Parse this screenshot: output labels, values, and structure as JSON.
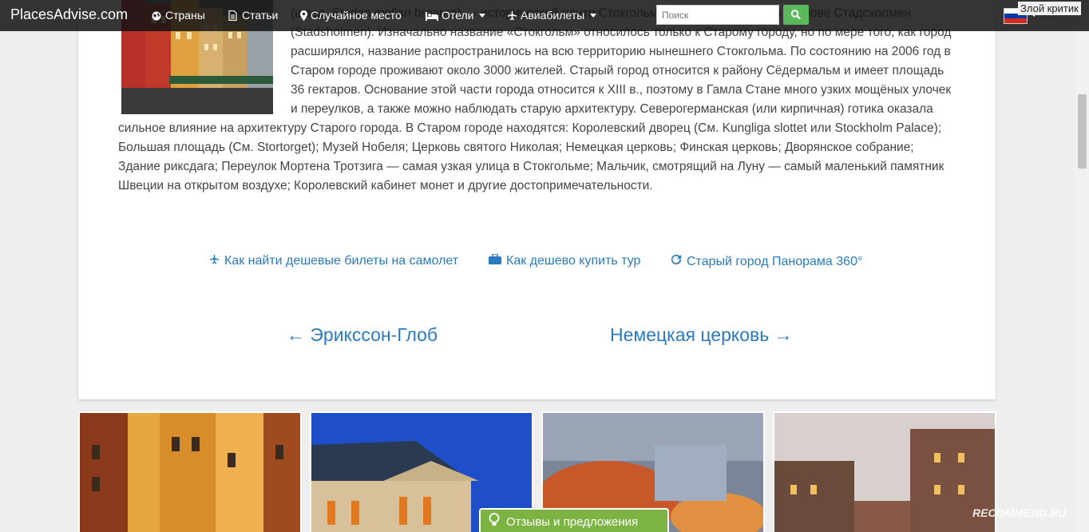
{
  "navbar": {
    "brand": "PlacesAdvise.com",
    "items": [
      {
        "label": "Страны",
        "icon": "globe-icon"
      },
      {
        "label": "Статьи",
        "icon": "file-icon"
      },
      {
        "label": "Случайное место",
        "icon": "map-marker-icon"
      },
      {
        "label": "Отели",
        "icon": "bed-icon"
      },
      {
        "label": "Авиабилеты",
        "icon": "plane-icon"
      }
    ],
    "search_placeholder": "Поиск",
    "user_label": "Злой критик"
  },
  "article": {
    "text": "(швед. Staden mellan broarna) — исторический центр Стокгольма, расположенный на острове Стадсхолмен (Stadsholmen). Изначально название «Стокгольм» относилось только к Старому городу, но по мере того, как город расширялся, название распространилось на всю территорию нынешнего Стокгольма. По состоянию на 2006 год в Старом городе проживают около 3000 жителей. Старый город относится к району Сёдермальм и имеет площадь 36 гектаров. Основание этой части города относится к XIII в., поэтому в Гамла Стане много узких мощёных улочек и переулков, а также можно наблюдать старую архитектуру. Северогерманская (или кирпичная) готика оказала сильное влияние на архитектуру Старого города. В Старом городе находятся: Королевский дворец (См. Kungliga slottet или Stockholm Palace); Большая площадь (См. Stortorget); Музей Нобеля; Церковь святого Николая; Немецкая церковь; Финская церковь; Дворянское собрание; Здание риксдага; Переулок Мортена Тротзига — самая узкая улица в Стокгольме; Мальчик, смотрящий на Луну — самый маленький памятник Швеции на открытом воздухе; Королевский кабинет монет и другие достопримечательности."
  },
  "links": [
    {
      "label": "Как найти дешевые билеты на самолет",
      "icon": "plane-icon"
    },
    {
      "label": "Как дешево купить тур",
      "icon": "suitcase-icon"
    },
    {
      "label": "Старый город Панорама 360°",
      "icon": "refresh-icon"
    }
  ],
  "pager": {
    "prev": "← Эрикссон-Глоб",
    "next": "Немецкая церковь →"
  },
  "feedback_label": "Отзывы и предложения",
  "watermark": "RECOMMEND.RU",
  "colors": {
    "link": "#2a7abf",
    "search_button": "#5cb85c",
    "feedback": "#7cb342"
  }
}
